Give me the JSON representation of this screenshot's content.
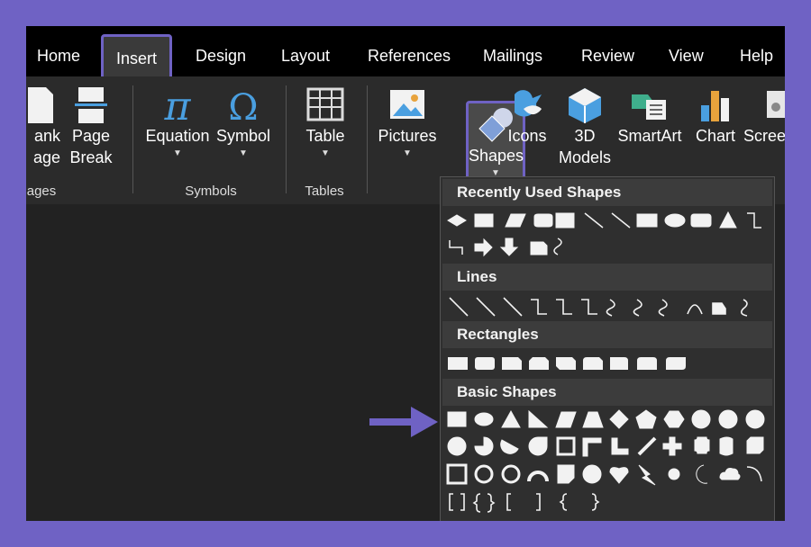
{
  "tabs": [
    {
      "label": "Home"
    },
    {
      "label": "Insert",
      "selected": true
    },
    {
      "label": "Design"
    },
    {
      "label": "Layout"
    },
    {
      "label": "References"
    },
    {
      "label": "Mailings"
    },
    {
      "label": "Review"
    },
    {
      "label": "View"
    },
    {
      "label": "Help"
    }
  ],
  "ribbon": {
    "blank_page": {
      "line1": "ank",
      "line2": "age"
    },
    "page_break": {
      "line1": "Page",
      "line2": "Break"
    },
    "pages_group": "ages",
    "equation": "Equation",
    "symbol": "Symbol",
    "symbols_group": "Symbols",
    "table": "Table",
    "tables_group": "Tables",
    "pictures": "Pictures",
    "shapes": "Shapes",
    "icons": "Icons",
    "models": {
      "line1": "3D",
      "line2": "Models"
    },
    "smartart": "SmartArt",
    "chart": "Chart",
    "screenshot": "Scree"
  },
  "shapes_menu": {
    "sections": [
      {
        "title": "Recently Used Shapes"
      },
      {
        "title": "Lines"
      },
      {
        "title": "Rectangles"
      },
      {
        "title": "Basic Shapes"
      }
    ]
  },
  "colors": {
    "frame": "#6f62c4",
    "highlight": "#6f62c4",
    "accent_blue": "#4a9fe0"
  }
}
